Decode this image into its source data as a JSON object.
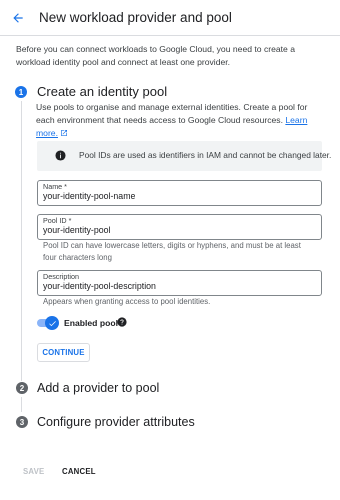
{
  "header": {
    "title": "New workload provider and pool",
    "back_icon": "arrow-back-icon"
  },
  "intro_text": "Before you can connect workloads to Google Cloud, you need to create a workload identity pool and connect at least one provider.",
  "steps": [
    {
      "number": "1",
      "title": "Create an identity pool",
      "description": "Use pools to organise and manage external identities. Create a pool for each environment that needs access to Google Cloud resources.",
      "learn_more": "Learn more."
    },
    {
      "number": "2",
      "title": "Add a provider to pool"
    },
    {
      "number": "3",
      "title": "Configure provider attributes"
    }
  ],
  "info_box": {
    "icon": "info-icon",
    "text": "Pool IDs are used as identifiers in IAM and cannot be changed later."
  },
  "fields": {
    "name": {
      "label": "Name *",
      "value": "your-identity-pool-name"
    },
    "pool_id": {
      "label": "Pool ID *",
      "value": "your-identity-pool",
      "helper": "Pool ID can have lowercase letters, digits or hyphens, and must be at least four characters long"
    },
    "description": {
      "label": "Description",
      "value": "your-identity-pool-description",
      "helper": "Appears when granting access to pool identities."
    }
  },
  "toggle": {
    "label": "Enabled pool",
    "enabled": true
  },
  "buttons": {
    "continue": "CONTINUE",
    "save": "SAVE",
    "cancel": "CANCEL"
  },
  "colors": {
    "accent": "#1a73e8",
    "inactive_step": "#5f6368",
    "info_bg": "#f1f3f4"
  }
}
